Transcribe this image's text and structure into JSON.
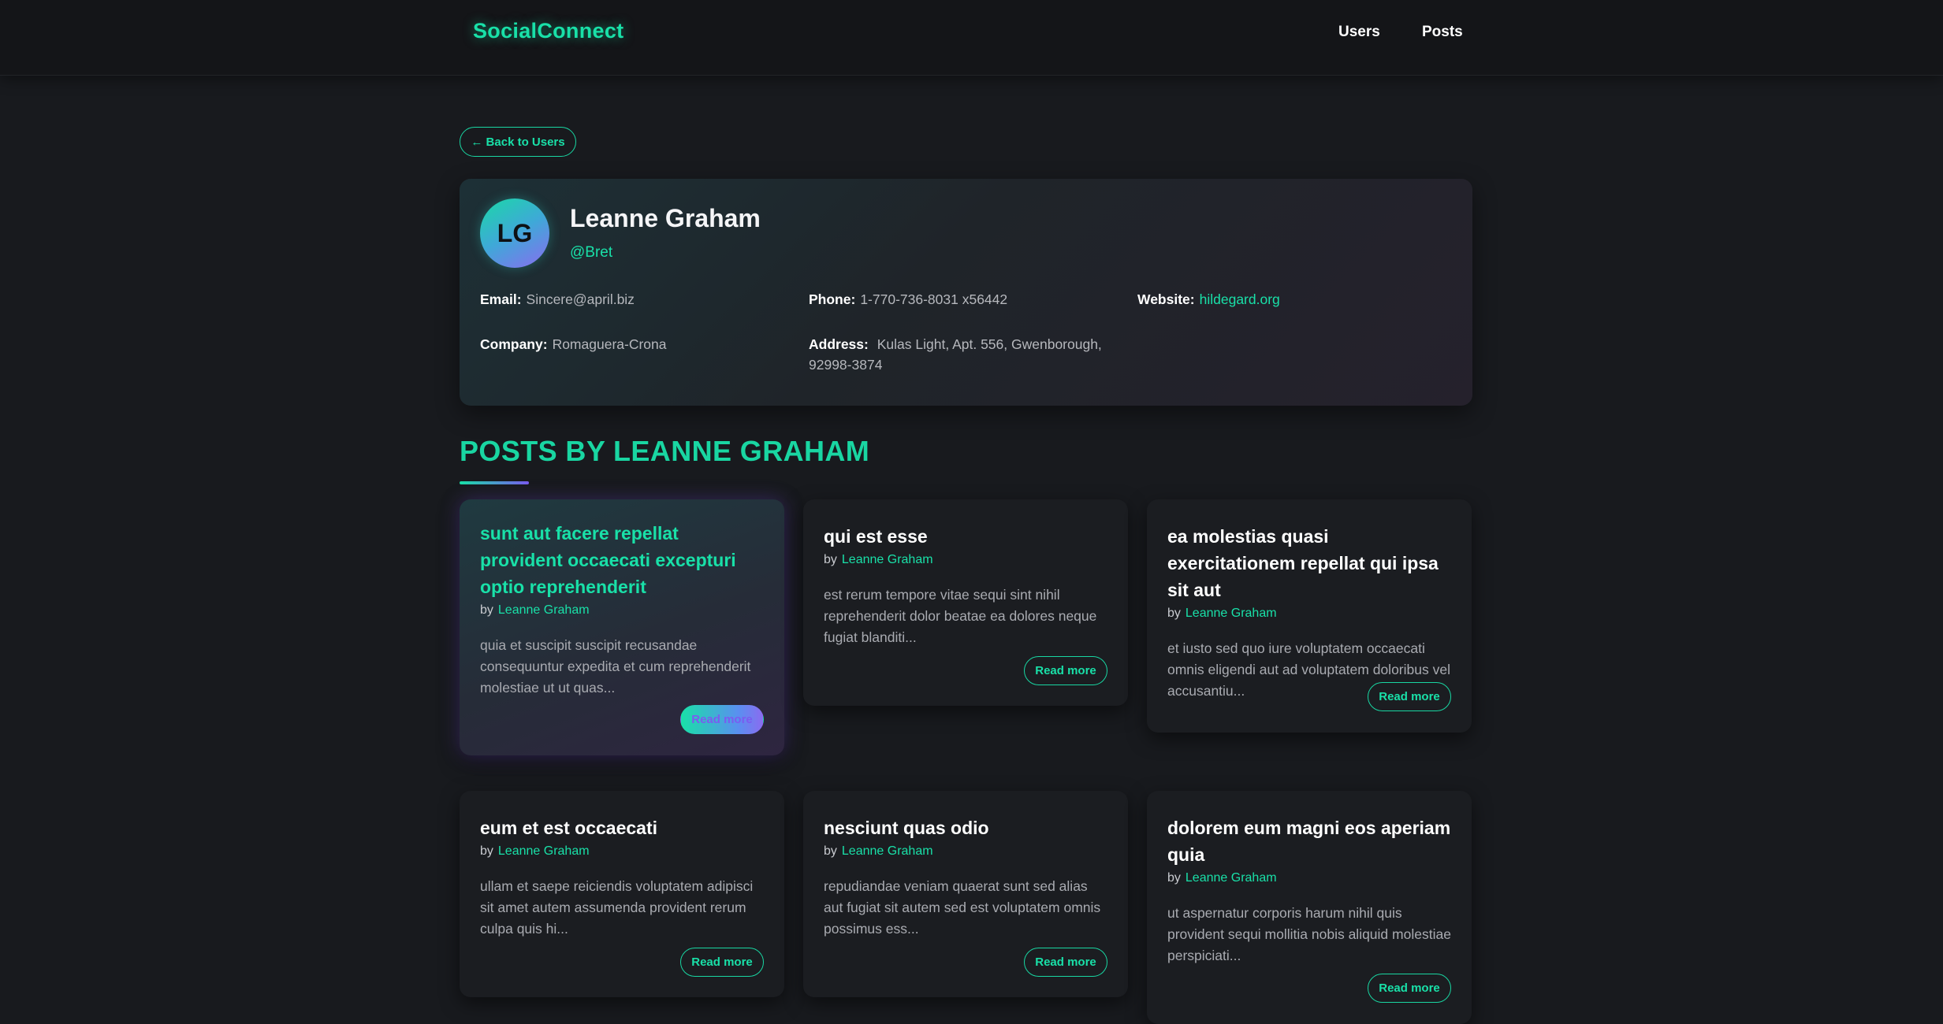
{
  "nav": {
    "brand": "SocialConnect",
    "links": [
      "Users",
      "Posts"
    ]
  },
  "back_label": "← Back to Users",
  "profile": {
    "initials": "LG",
    "name": "Leanne Graham",
    "username": "@Bret",
    "email_label": "Email:",
    "email": "Sincere@april.biz",
    "phone_label": "Phone:",
    "phone": "1-770-736-8031 x56442",
    "website_label": "Website:",
    "website": "hildegard.org",
    "company_label": "Company:",
    "company": "Romaguera-Crona",
    "address_label": "Address:",
    "address": "Kulas Light, Apt. 556, Gwenborough, 92998-3874"
  },
  "section_title": "POSTS BY LEANNE GRAHAM",
  "posts": [
    {
      "title": "sunt aut facere repellat provident occaecati excepturi optio reprehenderit",
      "by": "by",
      "author": "Leanne Graham",
      "body": "quia et suscipit suscipit recusandae consequuntur expedita et cum reprehenderit molestiae ut ut quas...",
      "read_more": "Read more"
    },
    {
      "title": "qui est esse",
      "by": "by",
      "author": "Leanne Graham",
      "body": "est rerum tempore vitae sequi sint nihil reprehenderit dolor beatae ea dolores neque fugiat blanditi...",
      "read_more": "Read more"
    },
    {
      "title": "ea molestias quasi exercitationem repellat qui ipsa sit aut",
      "by": "by",
      "author": "Leanne Graham",
      "body": "et iusto sed quo iure voluptatem occaecati omnis eligendi aut ad voluptatem doloribus vel accusantiu...",
      "read_more": "Read more"
    },
    {
      "title": "eum et est occaecati",
      "by": "by",
      "author": "Leanne Graham",
      "body": "ullam et saepe reiciendis voluptatem adipisci sit amet autem assumenda provident rerum culpa quis hi...",
      "read_more": "Read more"
    },
    {
      "title": "nesciunt quas odio",
      "by": "by",
      "author": "Leanne Graham",
      "body": "repudiandae veniam quaerat sunt sed alias aut fugiat sit autem sed est voluptatem omnis possimus ess...",
      "read_more": "Read more"
    },
    {
      "title": "dolorem eum magni eos aperiam quia",
      "by": "by",
      "author": "Leanne Graham",
      "body": "ut aspernatur corporis harum nihil quis provident sequi mollitia nobis aliquid molestiae perspiciati...",
      "read_more": "Read more"
    }
  ],
  "colors": {
    "accent": "#19e0a8",
    "accent_purple": "#8a6cf0",
    "background": "#181a1e",
    "card": "#1b1d21"
  }
}
